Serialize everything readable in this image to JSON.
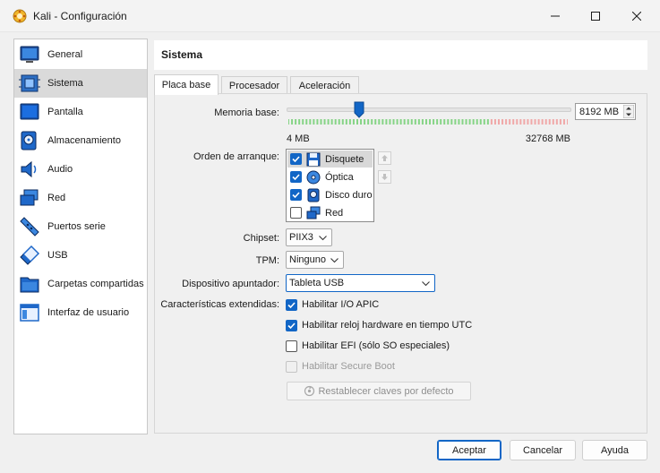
{
  "window": {
    "title": "Kali - Configuración"
  },
  "sidebar": {
    "items": [
      {
        "label": "General",
        "icon": "general-icon"
      },
      {
        "label": "Sistema",
        "icon": "system-icon",
        "selected": true
      },
      {
        "label": "Pantalla",
        "icon": "display-icon"
      },
      {
        "label": "Almacenamiento",
        "icon": "storage-icon"
      },
      {
        "label": "Audio",
        "icon": "audio-icon"
      },
      {
        "label": "Red",
        "icon": "network-icon"
      },
      {
        "label": "Puertos serie",
        "icon": "serial-ports-icon"
      },
      {
        "label": "USB",
        "icon": "usb-icon"
      },
      {
        "label": "Carpetas compartidas",
        "icon": "shared-folders-icon"
      },
      {
        "label": "Interfaz de usuario",
        "icon": "user-interface-icon"
      }
    ]
  },
  "header": {
    "title": "Sistema"
  },
  "tabs": [
    {
      "label": "Placa base",
      "active": true
    },
    {
      "label": "Procesador"
    },
    {
      "label": "Aceleración"
    }
  ],
  "motherboard": {
    "memory": {
      "label": "Memoria base:",
      "value": "8192 MB",
      "min_label": "4 MB",
      "max_label": "32768 MB",
      "fraction": 0.25
    },
    "boot_order": {
      "label": "Orden de arranque:",
      "items": [
        {
          "label": "Disquete",
          "checked": true,
          "icon": "floppy-icon"
        },
        {
          "label": "Óptica",
          "checked": true,
          "icon": "optical-disc-icon"
        },
        {
          "label": "Disco duro",
          "checked": true,
          "icon": "hard-disk-icon"
        },
        {
          "label": "Red",
          "checked": false,
          "icon": "network-boot-icon"
        }
      ]
    },
    "chipset": {
      "label": "Chipset:",
      "value": "PIIX3"
    },
    "tpm": {
      "label": "TPM:",
      "value": "Ninguno"
    },
    "pointing_device": {
      "label": "Dispositivo apuntador:",
      "value": "Tableta USB"
    },
    "extended": {
      "label": "Características extendidas:",
      "options": [
        {
          "label": "Habilitar I/O APIC",
          "checked": true,
          "enabled": true
        },
        {
          "label": "Habilitar reloj hardware en tiempo UTC",
          "checked": true,
          "enabled": true
        },
        {
          "label": "Habilitar EFI (sólo SO especiales)",
          "checked": false,
          "enabled": true
        },
        {
          "label": "Habilitar Secure Boot",
          "checked": false,
          "enabled": false
        }
      ]
    },
    "reset_keys_label": "Restablecer claves por defecto"
  },
  "buttons": {
    "accept": "Aceptar",
    "cancel": "Cancelar",
    "help": "Ayuda"
  },
  "colors": {
    "accent": "#1266c6",
    "slider_green": "#86d486",
    "slider_red": "#f0a8a8"
  }
}
